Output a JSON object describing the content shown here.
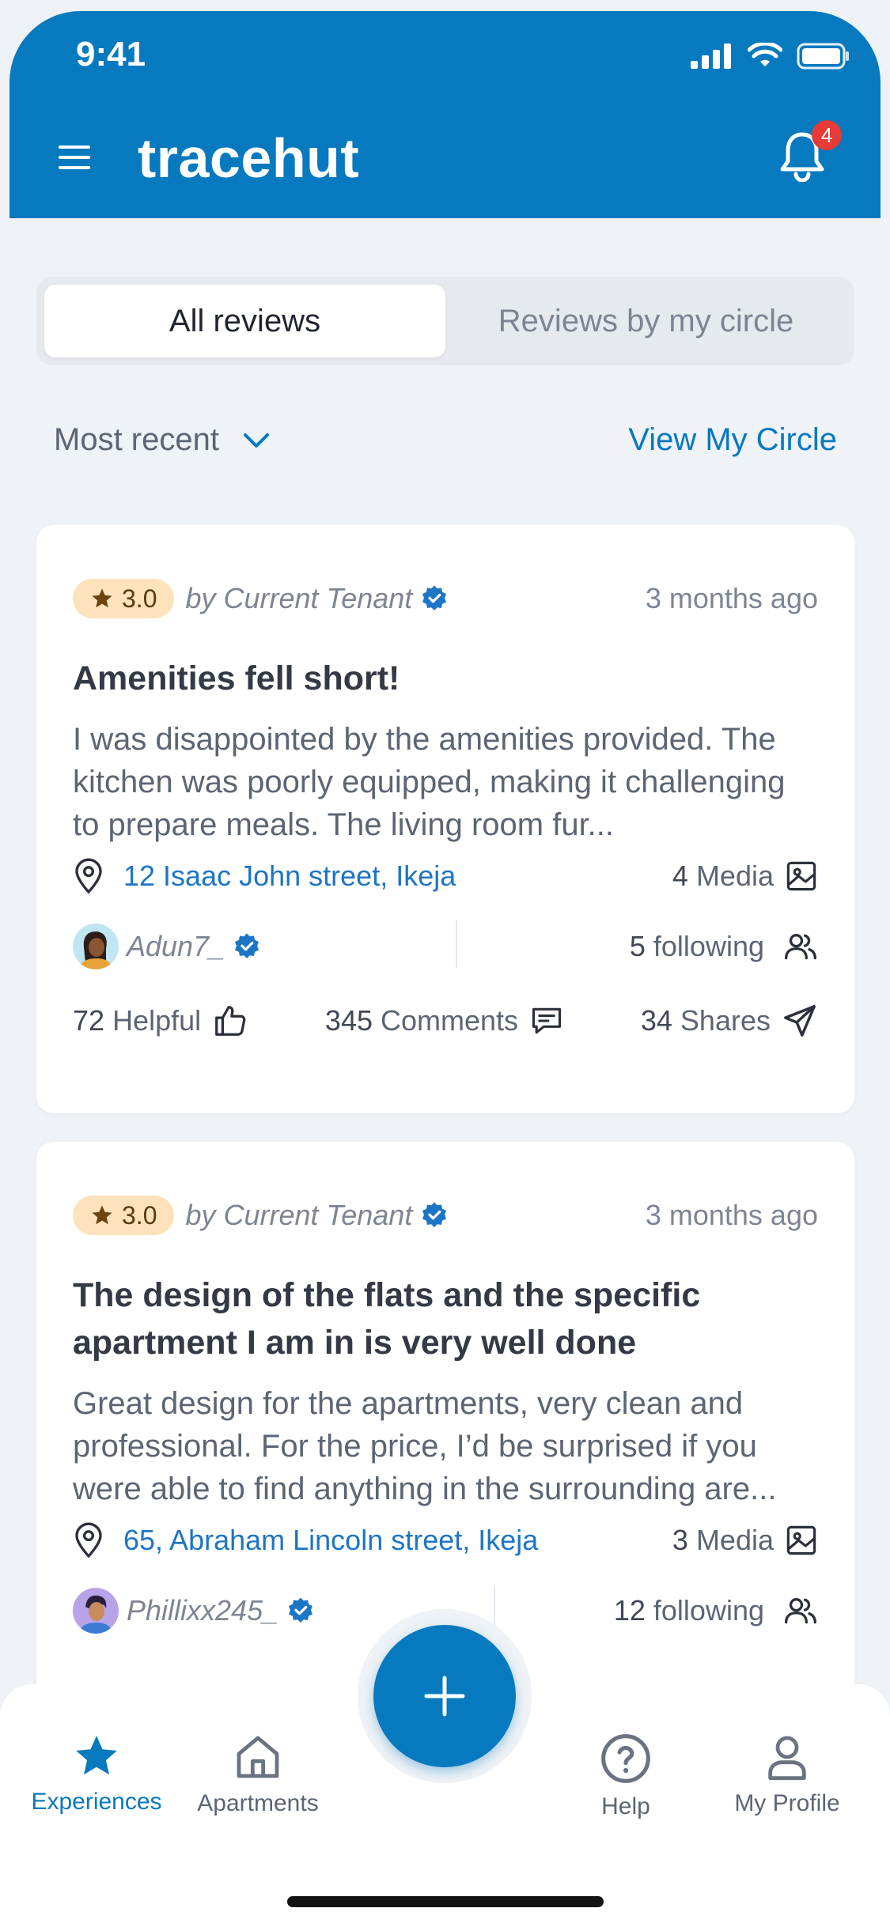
{
  "status_bar": {
    "time": "9:41"
  },
  "header": {
    "app_title": "tracehut",
    "notification_count": "4"
  },
  "tabs": [
    {
      "label": "All reviews",
      "active": true
    },
    {
      "label": "Reviews by my circle",
      "active": false
    }
  ],
  "filter": {
    "sort_label": "Most recent",
    "view_circle_label": "View My Circle"
  },
  "reviews": [
    {
      "rating": "3.0",
      "author_type": "by Current Tenant",
      "time": "3 months ago",
      "title": "Amenities fell short!",
      "body": "I was disappointed by the amenities provided. The kitchen was poorly equipped, making it challenging to prepare meals. The living room fur...",
      "address": "12 Isaac John street, Ikeja",
      "media_count": "4",
      "media_label": "Media",
      "username": "Adun7_",
      "following_count": "5",
      "following_label": "following",
      "helpful_count": "72",
      "helpful_label": "Helpful",
      "comments_count": "345",
      "comments_label": "Comments",
      "shares_count": "34",
      "shares_label": "Shares"
    },
    {
      "rating": "3.0",
      "author_type": "by Current Tenant",
      "time": "3 months ago",
      "title": "The design of the flats and the specific apartment I am in is very well done",
      "body": "Great design for the apartments, very clean and professional. For the price, I’d be surprised if you were able to find anything in the surrounding are...",
      "address": "65, Abraham Lincoln street, Ikeja",
      "media_count": "3",
      "media_label": "Media",
      "username": "Phillixx245_",
      "following_count": "12",
      "following_label": "following"
    }
  ],
  "bottom_nav": [
    {
      "label": "Experiences",
      "icon": "star-icon",
      "active": true
    },
    {
      "label": "Apartments",
      "icon": "home-icon",
      "active": false
    },
    {
      "label": "Help",
      "icon": "help-icon",
      "active": false
    },
    {
      "label": "My Profile",
      "icon": "profile-icon",
      "active": false
    }
  ],
  "colors": {
    "primary": "#0779bf",
    "rating_bg": "#fde2bb",
    "badge": "#e63b37",
    "link": "#1d75c6"
  }
}
